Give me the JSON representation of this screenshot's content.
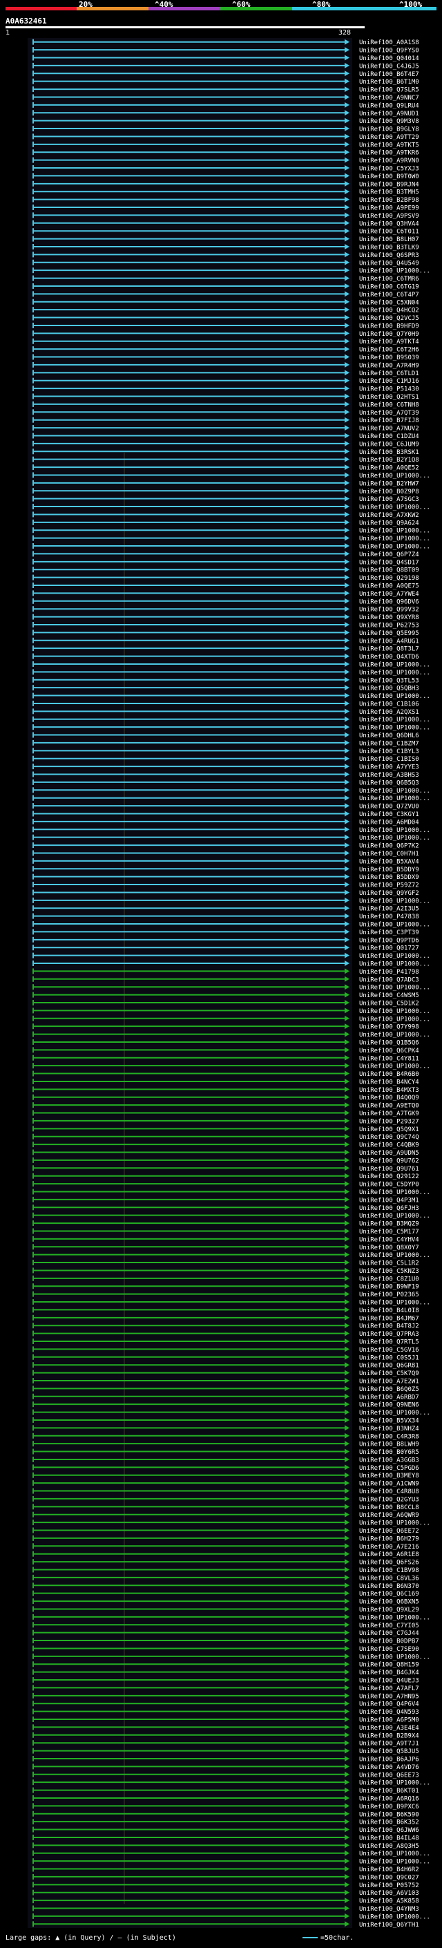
{
  "scale": {
    "ticks": [
      "20%",
      "^40%",
      "^60%",
      "^80%",
      "^100%"
    ],
    "colors": [
      "#e8192c",
      "#e8902c",
      "#a040c0",
      "#23b023",
      "#33c8e0"
    ]
  },
  "query": {
    "id": "A0A632461",
    "start": "1",
    "end": "328"
  },
  "legend": {
    "gaps_text": "Large gaps: ▲ (in Query) / — (in Subject)",
    "length_text": "=50char."
  },
  "colors": {
    "cyan": "#4cc9e6",
    "green": "#23b023",
    "white": "#ffffff",
    "background": "#000000"
  },
  "chart_data": {
    "type": "alignment",
    "xlim": [
      1,
      328
    ],
    "hits": [
      {
        "id": "UniRef100_A0A1S8",
        "color": "cyan"
      },
      {
        "id": "UniRef100_Q9FYS0",
        "color": "cyan"
      },
      {
        "id": "UniRef100_Q04014",
        "color": "cyan"
      },
      {
        "id": "UniRef100_C4J6J5",
        "color": "cyan"
      },
      {
        "id": "UniRef100_B6T4E7",
        "color": "cyan"
      },
      {
        "id": "UniRef100_B6T1M0",
        "color": "cyan"
      },
      {
        "id": "UniRef100_Q7SLR5",
        "color": "cyan"
      },
      {
        "id": "UniRef100_A9NNC7",
        "color": "cyan"
      },
      {
        "id": "UniRef100_Q9LRU4",
        "color": "cyan"
      },
      {
        "id": "UniRef100_A9NUD1",
        "color": "cyan"
      },
      {
        "id": "UniRef100_Q9M3V8",
        "color": "cyan"
      },
      {
        "id": "UniRef100_B9GLY8",
        "color": "cyan"
      },
      {
        "id": "UniRef100_A9TT29",
        "color": "cyan"
      },
      {
        "id": "UniRef100_A9TKT5",
        "color": "cyan"
      },
      {
        "id": "UniRef100_A9TKR6",
        "color": "cyan"
      },
      {
        "id": "UniRef100_A9RVN0",
        "color": "cyan"
      },
      {
        "id": "UniRef100_C5YXJ3",
        "color": "cyan"
      },
      {
        "id": "UniRef100_B9T0W0",
        "color": "cyan"
      },
      {
        "id": "UniRef100_B9RJN4",
        "color": "cyan"
      },
      {
        "id": "UniRef100_B3TMH5",
        "color": "cyan"
      },
      {
        "id": "UniRef100_B2BF98",
        "color": "cyan"
      },
      {
        "id": "UniRef100_A9PE99",
        "color": "cyan"
      },
      {
        "id": "UniRef100_A9PSV9",
        "color": "cyan"
      },
      {
        "id": "UniRef100_Q3HVA4",
        "color": "cyan"
      },
      {
        "id": "UniRef100_C6T011",
        "color": "cyan"
      },
      {
        "id": "UniRef100_B8LH07",
        "color": "cyan"
      },
      {
        "id": "UniRef100_B3TLK9",
        "color": "cyan"
      },
      {
        "id": "UniRef100_Q6SPR3",
        "color": "cyan"
      },
      {
        "id": "UniRef100_Q4U549",
        "color": "cyan"
      },
      {
        "id": "UniRef100_UP1000...",
        "color": "cyan"
      },
      {
        "id": "UniRef100_C6TMR6",
        "color": "cyan"
      },
      {
        "id": "UniRef100_C6TG19",
        "color": "cyan"
      },
      {
        "id": "UniRef100_C6T4P7",
        "color": "cyan"
      },
      {
        "id": "UniRef100_C5XN04",
        "color": "cyan"
      },
      {
        "id": "UniRef100_Q4HCQ2",
        "color": "cyan"
      },
      {
        "id": "UniRef100_Q2VCJ5",
        "color": "cyan"
      },
      {
        "id": "UniRef100_B9HFD9",
        "color": "cyan"
      },
      {
        "id": "UniRef100_Q7Y0H9",
        "color": "cyan"
      },
      {
        "id": "UniRef100_A9TKT4",
        "color": "cyan"
      },
      {
        "id": "UniRef100_C6T2H6",
        "color": "cyan"
      },
      {
        "id": "UniRef100_B9S039",
        "color": "cyan"
      },
      {
        "id": "UniRef100_A7R4H9",
        "color": "cyan"
      },
      {
        "id": "UniRef100_C6TLD1",
        "color": "cyan"
      },
      {
        "id": "UniRef100_C1MJ16",
        "color": "cyan"
      },
      {
        "id": "UniRef100_P51430",
        "color": "cyan"
      },
      {
        "id": "UniRef100_Q2HTS1",
        "color": "cyan"
      },
      {
        "id": "UniRef100_C6TNH8",
        "color": "cyan"
      },
      {
        "id": "UniRef100_A7QT39",
        "color": "cyan"
      },
      {
        "id": "UniRef100_B7FIJ8",
        "color": "cyan"
      },
      {
        "id": "UniRef100_A7NUV2",
        "color": "cyan"
      },
      {
        "id": "UniRef100_C1DZU4",
        "color": "cyan"
      },
      {
        "id": "UniRef100_C6JUM9",
        "color": "cyan"
      },
      {
        "id": "UniRef100_B3RSK1",
        "color": "cyan"
      },
      {
        "id": "UniRef100_B2Y1Q8",
        "color": "cyan"
      },
      {
        "id": "UniRef100_A0QE52",
        "color": "cyan"
      },
      {
        "id": "UniRef100_UP1000...",
        "color": "cyan"
      },
      {
        "id": "UniRef100_B2YHW7",
        "color": "cyan"
      },
      {
        "id": "UniRef100_B0Z9P8",
        "color": "cyan"
      },
      {
        "id": "UniRef100_A7SGC3",
        "color": "cyan"
      },
      {
        "id": "UniRef100_UP1000...",
        "color": "cyan"
      },
      {
        "id": "UniRef100_A7XKW2",
        "color": "cyan"
      },
      {
        "id": "UniRef100_Q9A624",
        "color": "cyan"
      },
      {
        "id": "UniRef100_UP1000...",
        "color": "cyan"
      },
      {
        "id": "UniRef100_UP1000...",
        "color": "cyan"
      },
      {
        "id": "UniRef100_UP1000...",
        "color": "cyan"
      },
      {
        "id": "UniRef100_Q6P7Z4",
        "color": "cyan"
      },
      {
        "id": "UniRef100_Q4SD17",
        "color": "cyan"
      },
      {
        "id": "UniRef100_Q8BT09",
        "color": "cyan"
      },
      {
        "id": "UniRef100_Q29198",
        "color": "cyan"
      },
      {
        "id": "UniRef100_A0QE75",
        "color": "cyan"
      },
      {
        "id": "UniRef100_A7YWE4",
        "color": "cyan"
      },
      {
        "id": "UniRef100_Q96DV6",
        "color": "cyan"
      },
      {
        "id": "UniRef100_Q99V32",
        "color": "cyan"
      },
      {
        "id": "UniRef100_Q9XYR8",
        "color": "cyan"
      },
      {
        "id": "UniRef100_P62753",
        "color": "cyan"
      },
      {
        "id": "UniRef100_Q5E995",
        "color": "cyan"
      },
      {
        "id": "UniRef100_A4RUG1",
        "color": "cyan"
      },
      {
        "id": "UniRef100_Q8T3L7",
        "color": "cyan"
      },
      {
        "id": "UniRef100_Q4XTD6",
        "color": "cyan"
      },
      {
        "id": "UniRef100_UP1000...",
        "color": "cyan"
      },
      {
        "id": "UniRef100_UP1000...",
        "color": "cyan"
      },
      {
        "id": "UniRef100_Q3TL53",
        "color": "cyan"
      },
      {
        "id": "UniRef100_Q5QBH3",
        "color": "cyan"
      },
      {
        "id": "UniRef100_UP1000...",
        "color": "cyan"
      },
      {
        "id": "UniRef100_C1B106",
        "color": "cyan"
      },
      {
        "id": "UniRef100_A2QXS1",
        "color": "cyan"
      },
      {
        "id": "UniRef100_UP1000...",
        "color": "cyan"
      },
      {
        "id": "UniRef100_UP1000...",
        "color": "cyan"
      },
      {
        "id": "UniRef100_Q6DHL6",
        "color": "cyan"
      },
      {
        "id": "UniRef100_C1BZM7",
        "color": "cyan"
      },
      {
        "id": "UniRef100_C1BYL3",
        "color": "cyan"
      },
      {
        "id": "UniRef100_C1BIS0",
        "color": "cyan"
      },
      {
        "id": "UniRef100_A7YYE3",
        "color": "cyan"
      },
      {
        "id": "UniRef100_A3BHS3",
        "color": "cyan"
      },
      {
        "id": "UniRef100_Q6B5Q3",
        "color": "cyan"
      },
      {
        "id": "UniRef100_UP1000...",
        "color": "cyan"
      },
      {
        "id": "UniRef100_UP1000...",
        "color": "cyan"
      },
      {
        "id": "UniRef100_Q7ZVU0",
        "color": "cyan"
      },
      {
        "id": "UniRef100_C3KGY1",
        "color": "cyan"
      },
      {
        "id": "UniRef100_A6MD04",
        "color": "cyan"
      },
      {
        "id": "UniRef100_UP1000...",
        "color": "cyan"
      },
      {
        "id": "UniRef100_UP1000...",
        "color": "cyan"
      },
      {
        "id": "UniRef100_Q6P7K2",
        "color": "cyan"
      },
      {
        "id": "UniRef100_C0H7H1",
        "color": "cyan"
      },
      {
        "id": "UniRef100_B5XAV4",
        "color": "cyan"
      },
      {
        "id": "UniRef100_B5DDY9",
        "color": "cyan"
      },
      {
        "id": "UniRef100_B5DDX9",
        "color": "cyan"
      },
      {
        "id": "UniRef100_P59Z72",
        "color": "cyan"
      },
      {
        "id": "UniRef100_Q9YGF2",
        "color": "cyan"
      },
      {
        "id": "UniRef100_UP1000...",
        "color": "cyan"
      },
      {
        "id": "UniRef100_A2I3U5",
        "color": "cyan"
      },
      {
        "id": "UniRef100_P47838",
        "color": "cyan"
      },
      {
        "id": "UniRef100_UP1000...",
        "color": "cyan"
      },
      {
        "id": "UniRef100_C3PT39",
        "color": "cyan"
      },
      {
        "id": "UniRef100_Q9PTD6",
        "color": "cyan"
      },
      {
        "id": "UniRef100_Q01727",
        "color": "cyan"
      },
      {
        "id": "UniRef100_UP1000...",
        "color": "cyan"
      },
      {
        "id": "UniRef100_UP1000...",
        "color": "cyan"
      },
      {
        "id": "UniRef100_P41798",
        "color": "green"
      },
      {
        "id": "UniRef100_Q7ADC3",
        "color": "green"
      },
      {
        "id": "UniRef100_UP1000...",
        "color": "green"
      },
      {
        "id": "UniRef100_C4WSM5",
        "color": "green"
      },
      {
        "id": "UniRef100_C5D1K2",
        "color": "green"
      },
      {
        "id": "UniRef100_UP1000...",
        "color": "green"
      },
      {
        "id": "UniRef100_UP1000...",
        "color": "green"
      },
      {
        "id": "UniRef100_Q7Y998",
        "color": "green"
      },
      {
        "id": "UniRef100_UP1000...",
        "color": "green"
      },
      {
        "id": "UniRef100_Q1B5Q6",
        "color": "green"
      },
      {
        "id": "UniRef100_Q6CPK4",
        "color": "green"
      },
      {
        "id": "UniRef100_C4Y811",
        "color": "green"
      },
      {
        "id": "UniRef100_UP1000...",
        "color": "green"
      },
      {
        "id": "UniRef100_B4R6B0",
        "color": "green"
      },
      {
        "id": "UniRef100_B4NCY4",
        "color": "green"
      },
      {
        "id": "UniRef100_B4MXT3",
        "color": "green"
      },
      {
        "id": "UniRef100_B4Q0Q9",
        "color": "green"
      },
      {
        "id": "UniRef100_A9ETQ0",
        "color": "green"
      },
      {
        "id": "UniRef100_A7TGK9",
        "color": "green"
      },
      {
        "id": "UniRef100_P29327",
        "color": "green"
      },
      {
        "id": "UniRef100_Q5Q9X1",
        "color": "green"
      },
      {
        "id": "UniRef100_Q9C74Q",
        "color": "green"
      },
      {
        "id": "UniRef100_C4QBK9",
        "color": "green"
      },
      {
        "id": "UniRef100_A9UDN5",
        "color": "green"
      },
      {
        "id": "UniRef100_Q9U762",
        "color": "green"
      },
      {
        "id": "UniRef100_Q9U761",
        "color": "green"
      },
      {
        "id": "UniRef100_Q29122",
        "color": "green"
      },
      {
        "id": "UniRef100_C5DYP0",
        "color": "green"
      },
      {
        "id": "UniRef100_UP1000...",
        "color": "green"
      },
      {
        "id": "UniRef100_Q4P3M1",
        "color": "green"
      },
      {
        "id": "UniRef100_Q6FJH3",
        "color": "green"
      },
      {
        "id": "UniRef100_UP1000...",
        "color": "green"
      },
      {
        "id": "UniRef100_B3MQZ9",
        "color": "green"
      },
      {
        "id": "UniRef100_C5M177",
        "color": "green"
      },
      {
        "id": "UniRef100_C4YHV4",
        "color": "green"
      },
      {
        "id": "UniRef100_Q8X0Y7",
        "color": "green"
      },
      {
        "id": "UniRef100_UP1000...",
        "color": "green"
      },
      {
        "id": "UniRef100_C5L1R2",
        "color": "green"
      },
      {
        "id": "UniRef100_C5KNZ3",
        "color": "green"
      },
      {
        "id": "UniRef100_C8Z1U0",
        "color": "green"
      },
      {
        "id": "UniRef100_B9WF19",
        "color": "green"
      },
      {
        "id": "UniRef100_P02365",
        "color": "green"
      },
      {
        "id": "UniRef100_UP1000...",
        "color": "green"
      },
      {
        "id": "UniRef100_B4L0I8",
        "color": "green"
      },
      {
        "id": "UniRef100_B4JM67",
        "color": "green"
      },
      {
        "id": "UniRef100_B4T8J2",
        "color": "green"
      },
      {
        "id": "UniRef100_Q7PRA3",
        "color": "green"
      },
      {
        "id": "UniRef100_Q7RTL5",
        "color": "green"
      },
      {
        "id": "UniRef100_C5GV16",
        "color": "green"
      },
      {
        "id": "UniRef100_C0S5J1",
        "color": "green"
      },
      {
        "id": "UniRef100_Q6GR81",
        "color": "green"
      },
      {
        "id": "UniRef100_C5K7Q9",
        "color": "green"
      },
      {
        "id": "UniRef100_A7E2W1",
        "color": "green"
      },
      {
        "id": "UniRef100_B6Q0Z5",
        "color": "green"
      },
      {
        "id": "UniRef100_A6RBD7",
        "color": "green"
      },
      {
        "id": "UniRef100_Q9NEN6",
        "color": "green"
      },
      {
        "id": "UniRef100_UP1000...",
        "color": "green"
      },
      {
        "id": "UniRef100_B5VX34",
        "color": "green"
      },
      {
        "id": "UniRef100_B3NHZ4",
        "color": "green"
      },
      {
        "id": "UniRef100_C4R3R8",
        "color": "green"
      },
      {
        "id": "UniRef100_B8LWH9",
        "color": "green"
      },
      {
        "id": "UniRef100_B0Y6R5",
        "color": "green"
      },
      {
        "id": "UniRef100_A3GGB3",
        "color": "green"
      },
      {
        "id": "UniRef100_C5PGD6",
        "color": "green"
      },
      {
        "id": "UniRef100_B3MEY8",
        "color": "green"
      },
      {
        "id": "UniRef100_A1CWN9",
        "color": "green"
      },
      {
        "id": "UniRef100_C4R8U8",
        "color": "green"
      },
      {
        "id": "UniRef100_Q2GYU3",
        "color": "green"
      },
      {
        "id": "UniRef100_B8CCL8",
        "color": "green"
      },
      {
        "id": "UniRef100_A6QWR9",
        "color": "green"
      },
      {
        "id": "UniRef100_UP1000...",
        "color": "green"
      },
      {
        "id": "UniRef100_Q6EE72",
        "color": "green"
      },
      {
        "id": "UniRef100_B6H279",
        "color": "green"
      },
      {
        "id": "UniRef100_A7E216",
        "color": "green"
      },
      {
        "id": "UniRef100_A6R1E8",
        "color": "green"
      },
      {
        "id": "UniRef100_Q6FS26",
        "color": "green"
      },
      {
        "id": "UniRef100_C1BV98",
        "color": "green"
      },
      {
        "id": "UniRef100_C8VL36",
        "color": "green"
      },
      {
        "id": "UniRef100_B6N370",
        "color": "green"
      },
      {
        "id": "UniRef100_Q6C169",
        "color": "green"
      },
      {
        "id": "UniRef100_Q6BXN5",
        "color": "green"
      },
      {
        "id": "UniRef100_Q9XL29",
        "color": "green"
      },
      {
        "id": "UniRef100_UP1000...",
        "color": "green"
      },
      {
        "id": "UniRef100_C7YI05",
        "color": "green"
      },
      {
        "id": "UniRef100_C7GJ44",
        "color": "green"
      },
      {
        "id": "UniRef100_B0DPB7",
        "color": "green"
      },
      {
        "id": "UniRef100_C7SE90",
        "color": "green"
      },
      {
        "id": "UniRef100_UP1000...",
        "color": "green"
      },
      {
        "id": "UniRef100_Q8H159",
        "color": "green"
      },
      {
        "id": "UniRef100_B4GJK4",
        "color": "green"
      },
      {
        "id": "UniRef100_Q4UEJ3",
        "color": "green"
      },
      {
        "id": "UniRef100_A7AFL7",
        "color": "green"
      },
      {
        "id": "UniRef100_A7HN95",
        "color": "green"
      },
      {
        "id": "UniRef100_Q4P6V4",
        "color": "green"
      },
      {
        "id": "UniRef100_Q4N593",
        "color": "green"
      },
      {
        "id": "UniRef100_A6P5M0",
        "color": "green"
      },
      {
        "id": "UniRef100_A3E4E4",
        "color": "green"
      },
      {
        "id": "UniRef100_B2B9X4",
        "color": "green"
      },
      {
        "id": "UniRef100_A9T7J1",
        "color": "green"
      },
      {
        "id": "UniRef100_Q5BJU5",
        "color": "green"
      },
      {
        "id": "UniRef100_B6AJP6",
        "color": "green"
      },
      {
        "id": "UniRef100_A4VD76",
        "color": "green"
      },
      {
        "id": "UniRef100_Q6EE73",
        "color": "green"
      },
      {
        "id": "UniRef100_UP1000...",
        "color": "green"
      },
      {
        "id": "UniRef100_B6KT01",
        "color": "green"
      },
      {
        "id": "UniRef100_A6RQ16",
        "color": "green"
      },
      {
        "id": "UniRef100_B9PXC6",
        "color": "green"
      },
      {
        "id": "UniRef100_B6K590",
        "color": "green"
      },
      {
        "id": "UniRef100_B6K352",
        "color": "green"
      },
      {
        "id": "UniRef100_Q6JWW6",
        "color": "green"
      },
      {
        "id": "UniRef100_B4IL48",
        "color": "green"
      },
      {
        "id": "UniRef100_A8Q3H5",
        "color": "green"
      },
      {
        "id": "UniRef100_UP1000...",
        "color": "green"
      },
      {
        "id": "UniRef100_UP1000...",
        "color": "green"
      },
      {
        "id": "UniRef100_B4H6R2",
        "color": "green"
      },
      {
        "id": "UniRef100_Q9C027",
        "color": "green"
      },
      {
        "id": "UniRef100_P05752",
        "color": "green"
      },
      {
        "id": "UniRef100_A6V103",
        "color": "green"
      },
      {
        "id": "UniRef100_A5K858",
        "color": "green"
      },
      {
        "id": "UniRef100_Q4YNM3",
        "color": "green"
      },
      {
        "id": "UniRef100_UP1000...",
        "color": "green"
      },
      {
        "id": "UniRef100_Q6YTH1",
        "color": "green"
      }
    ]
  }
}
